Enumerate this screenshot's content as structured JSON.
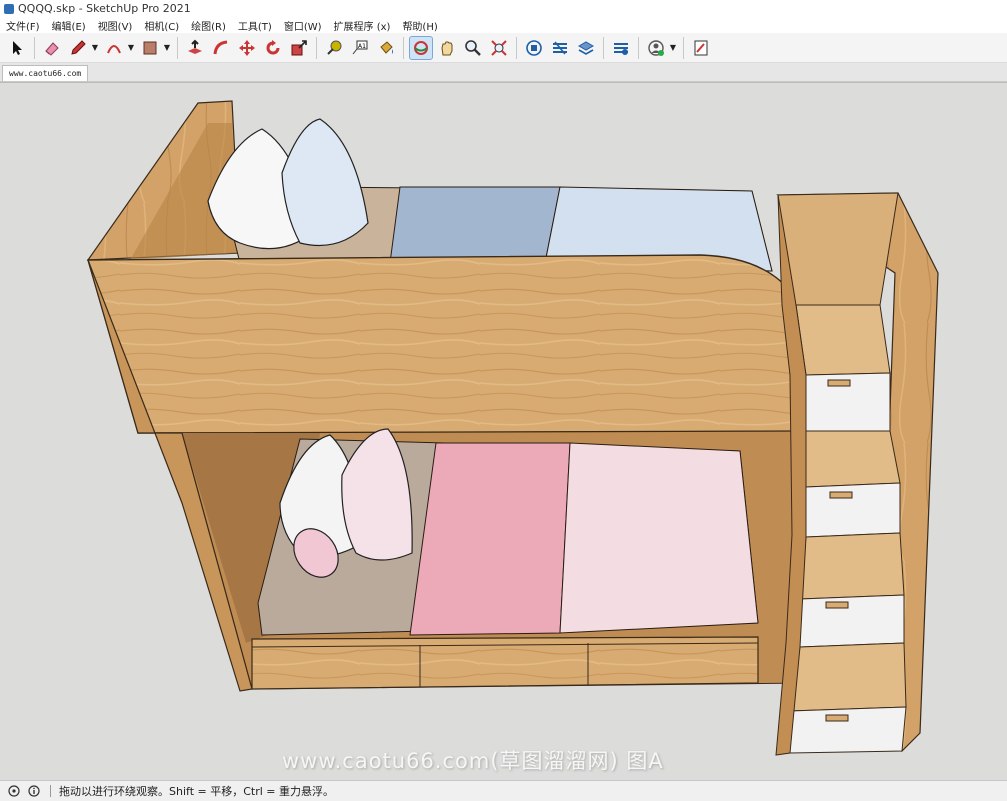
{
  "window": {
    "title": "QQQQ.skp - SketchUp Pro 2021"
  },
  "menu": [
    "文件(F)",
    "编辑(E)",
    "视图(V)",
    "相机(C)",
    "绘图(R)",
    "工具(T)",
    "窗口(W)",
    "扩展程序 (x)",
    "帮助(H)"
  ],
  "scene_tab": {
    "label": "www.caotu66.com"
  },
  "watermark": "www.caotu66.com(草图溜溜网) 图A",
  "status": {
    "hint": "拖动以进行环绕观察。Shift = 平移，Ctrl = 重力悬浮。"
  },
  "colors": {
    "wood": "#d8ab72",
    "wood_dark": "#b8864c",
    "bg": "#dcdcda",
    "pink": "#ecaab9",
    "blue": "#a3b6cf"
  }
}
